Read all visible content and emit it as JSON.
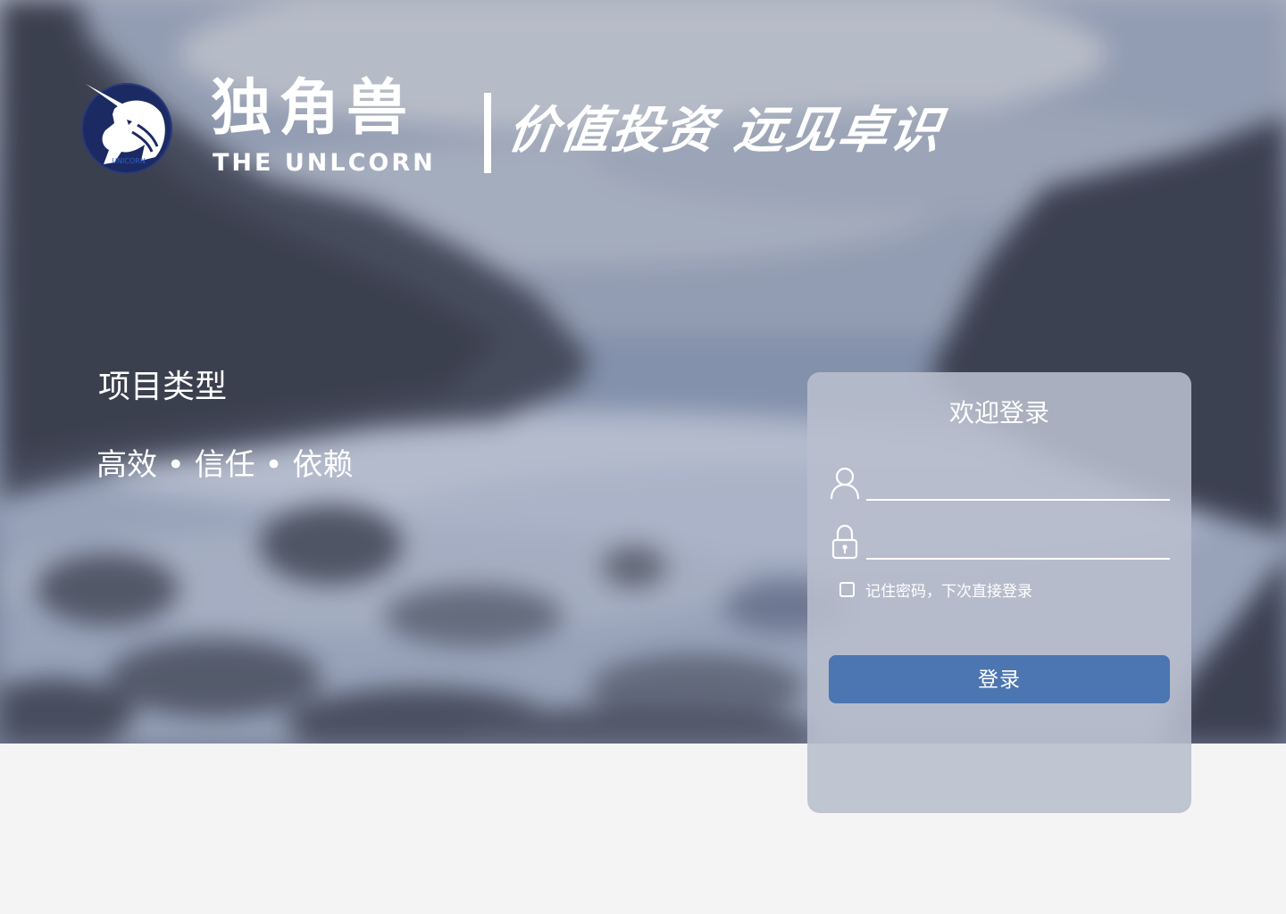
{
  "brand": {
    "name_cn": "独角兽",
    "name_en": "THE UNLCORN",
    "logo_text": "UNICORN",
    "slogan": "价值投资 远见卓识"
  },
  "intro": {
    "title": "项目类型",
    "tagline": "高效 • 信任 • 依赖"
  },
  "login": {
    "title": "欢迎登录",
    "username": {
      "value": "",
      "placeholder": ""
    },
    "password": {
      "value": "",
      "placeholder": ""
    },
    "remember": {
      "checked": false,
      "label": "记住密码，下次直接登录"
    },
    "submit_label": "登录"
  },
  "icons": {
    "logo": "unicorn-logo-icon",
    "user": "user-icon",
    "password": "lock-icon",
    "remember": "checkbox-icon"
  },
  "colors": {
    "accent": "#4c76b2",
    "panel": "#b8becd",
    "page_background": "#f4f4f5",
    "logo_navy": "#1b2a62"
  }
}
